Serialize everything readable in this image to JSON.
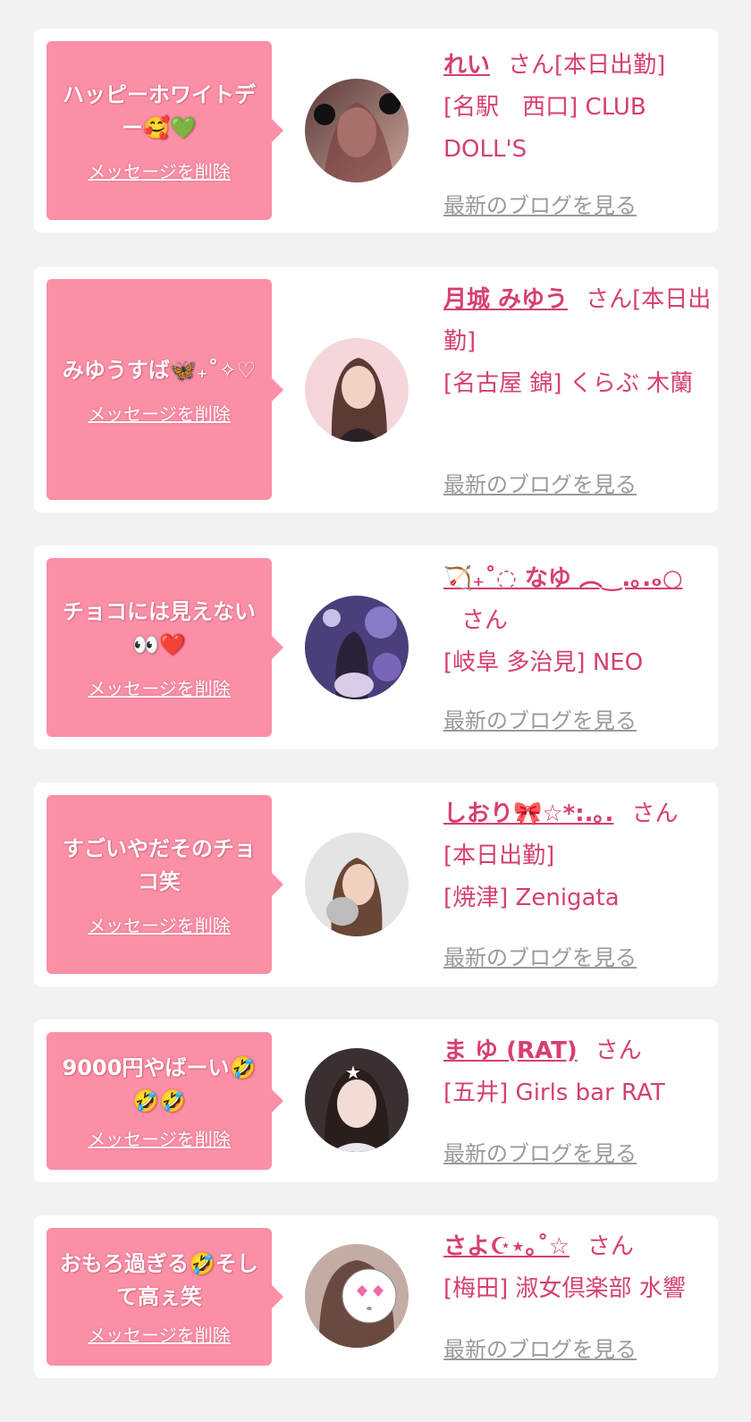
{
  "delete_label": "メッセージを削除",
  "blog_label": "最新のブログを見る",
  "san_label": "さん",
  "colors": {
    "bubble": "#fb8fa6",
    "accent": "#d63f72",
    "link_gray": "#9a9a9a",
    "background": "#f2f2f2"
  },
  "entries": [
    {
      "message": "ハッピーホワイトデー🥰💚",
      "name": "れい",
      "status": "[本日出勤]",
      "location": "[名駅　西口] CLUB DOLL'S"
    },
    {
      "message": "みゆうすば🦋₊˚✧♡",
      "name": "月城 みゆう",
      "status": "[本日出勤]",
      "location": "[名古屋 錦] くらぶ 木蘭"
    },
    {
      "message": "チョコには見えない👀❤️",
      "name": "🏹₊˚◌ なゆ ︵‿.｡.ₒ○",
      "status": "",
      "location": "[岐阜 多治見] NEO"
    },
    {
      "message": "すごいやだそのチョコ笑",
      "name": "しおり🎀☆*:.｡.",
      "status": "[本日出勤]",
      "location": "[焼津] Zenigata"
    },
    {
      "message": "9000円やばーい🤣🤣🤣",
      "name": "ま ゆ (RAT)",
      "status": "",
      "location": "[五井] Girls bar RAT"
    },
    {
      "message": "おもろ過ぎる🤣そして高ぇ笑",
      "name": "さよ☪︎⋆｡˚☆",
      "status": "",
      "location": "[梅田] 淑女倶楽部 水響"
    }
  ]
}
